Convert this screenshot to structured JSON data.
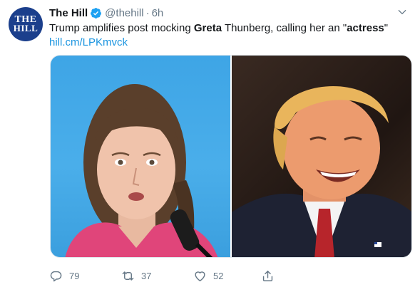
{
  "tweet": {
    "avatar_text_top": "THE",
    "avatar_text_bottom": "HILL",
    "display_name": "The Hill",
    "handle": "@thehill",
    "separator": "·",
    "time": "6h",
    "text_part1": "Trump amplifies post mocking ",
    "text_bold1": "Greta",
    "text_part2": " Thunberg, calling her an \"",
    "text_bold2": "actress",
    "text_part3": "\"",
    "link": "hill.cm/LPKmvck"
  },
  "actions": {
    "reply_count": "79",
    "retweet_count": "37",
    "like_count": "52"
  },
  "colors": {
    "accent": "#1b95e0",
    "verified": "#1da1f2",
    "muted": "#657786",
    "avatar_bg": "#1b3f8c"
  },
  "icons": [
    "verified-badge-icon",
    "chevron-down-icon",
    "reply-icon",
    "retweet-icon",
    "like-icon",
    "share-icon"
  ]
}
